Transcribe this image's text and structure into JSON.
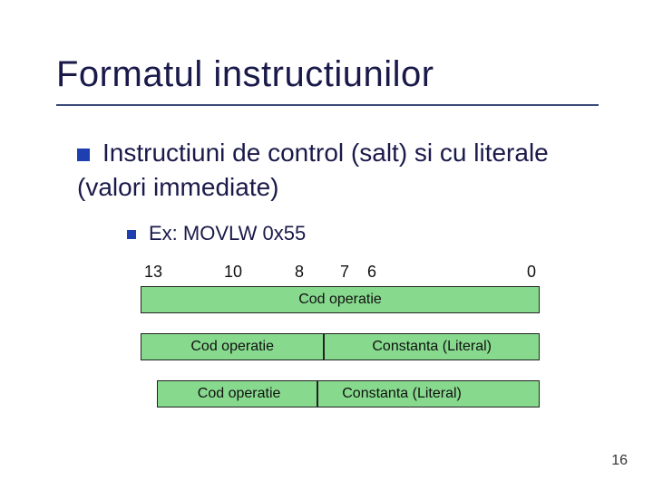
{
  "title": "Formatul instructiunilor",
  "bullet1": "Instructiuni de control (salt) si cu literale (valori immediate)",
  "bullet2": "Ex: MOVLW   0x55",
  "bits": {
    "b13": "13",
    "b10": "10",
    "b8": "8",
    "b7": "7",
    "b6": "6",
    "b0": "0"
  },
  "row1": {
    "seg1": "Cod operatie"
  },
  "row2": {
    "seg1": "Cod operatie",
    "seg2": "Constanta (Literal)"
  },
  "row3": {
    "seg1": "Cod operatie",
    "seg2": "Constanta (Literal)"
  },
  "page": "16"
}
